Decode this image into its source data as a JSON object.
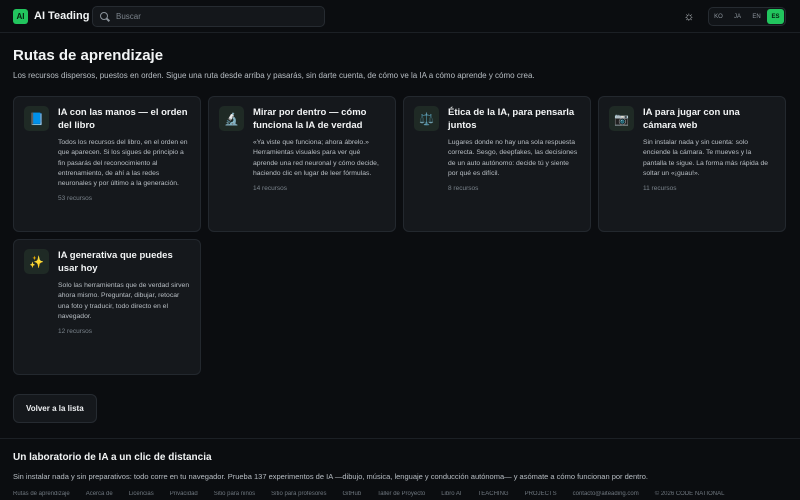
{
  "header": {
    "logo_mark": "AI",
    "logo_text": "AI Teading",
    "search_placeholder": "Buscar",
    "theme_icon": "sun-icon",
    "languages": [
      "KO",
      "JA",
      "EN",
      "ES"
    ],
    "active_language": "ES"
  },
  "main": {
    "title": "Rutas de aprendizaje",
    "subtitle": "Los recursos dispersos, puestos en orden. Sigue una ruta desde arriba y pasarás, sin darte cuenta, de cómo ve la IA a cómo aprende y cómo crea.",
    "cards": [
      {
        "icon": "📘",
        "icon_name": "book-icon",
        "title": "IA con las manos — el orden del libro",
        "desc": "Todos los recursos del libro, en el orden en que aparecen. Si los sigues de principio a fin pasarás del reconocimiento al entrenamiento, de ahí a las redes neuronales y por último a la generación.",
        "count": "53 recursos"
      },
      {
        "icon": "🔬",
        "icon_name": "microscope-icon",
        "title": "Mirar por dentro — cómo funciona la IA de verdad",
        "desc": "«Ya viste que funciona; ahora ábrelo.» Herramientas visuales para ver qué aprende una red neuronal y cómo decide, haciendo clic en lugar de leer fórmulas.",
        "count": "14 recursos"
      },
      {
        "icon": "⚖️",
        "icon_name": "scales-icon",
        "title": "Ética de la IA, para pensarla juntos",
        "desc": "Lugares donde no hay una sola respuesta correcta. Sesgo, deepfakes, las decisiones de un auto autónomo: decide tú y siente por qué es difícil.",
        "count": "8 recursos"
      },
      {
        "icon": "📷",
        "icon_name": "camera-icon",
        "title": "IA para jugar con una cámara web",
        "desc": "Sin instalar nada y sin cuenta: solo enciende la cámara. Te mueves y la pantalla te sigue. La forma más rápida de soltar un «¡guau!».",
        "count": "11 recursos"
      },
      {
        "icon": "✨",
        "icon_name": "sparkles-icon",
        "title": "IA generativa que puedes usar hoy",
        "desc": "Solo las herramientas que de verdad sirven ahora mismo. Preguntar, dibujar, retocar una foto y traducir, todo directo en el navegador.",
        "count": "12 recursos"
      }
    ],
    "back_label": "Volver a la lista"
  },
  "footer": {
    "title": "Un laboratorio de IA a un clic de distancia",
    "desc": "Sin instalar nada y sin preparativos: todo corre en tu navegador. Prueba 137 experimentos de IA —dibujo, música, lenguaje y conducción autónoma— y asómate a cómo funcionan por dentro.",
    "links": [
      "Rutas de aprendizaje",
      "Acerca de",
      "Licencias",
      "Privacidad",
      "Sitio para niños",
      "Sitio para profesores",
      "GitHub",
      "Taller de Proyecto",
      "Libro AI",
      "TEACHING",
      "PROJECTS",
      "contacto@aiteading.com",
      "© 2026 CODE NATIONAL"
    ]
  }
}
